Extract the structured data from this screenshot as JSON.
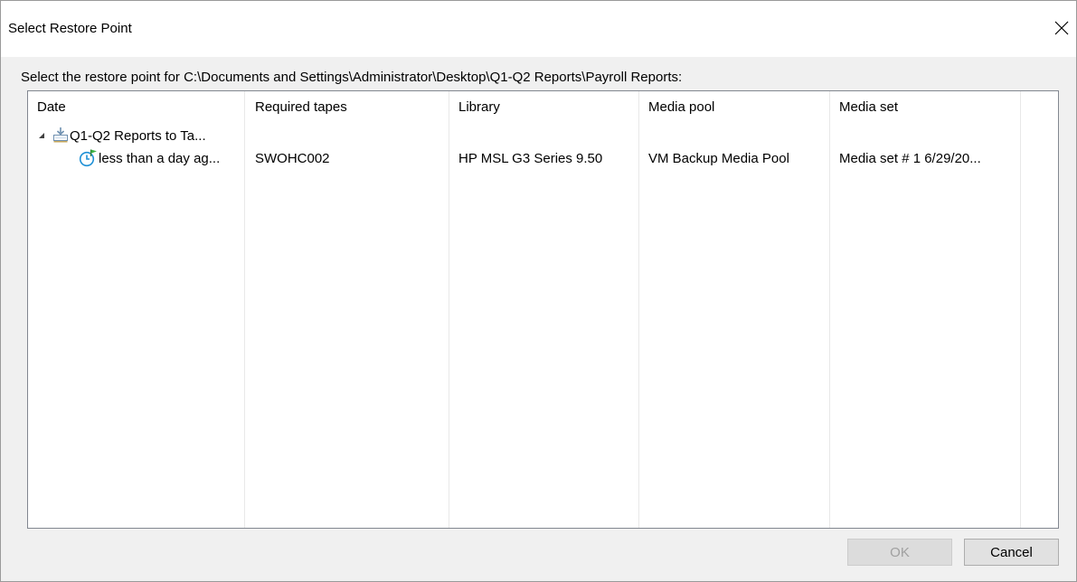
{
  "window": {
    "title": "Select Restore Point"
  },
  "prompt": "Select the restore point for C:\\Documents and Settings\\Administrator\\Desktop\\Q1-Q2 Reports\\Payroll Reports:",
  "table": {
    "columns": [
      "Date",
      "Required tapes",
      "Library",
      "Media pool",
      "Media set"
    ],
    "group": {
      "label": "Q1-Q2 Reports to Ta...",
      "icon": "backup-job-icon",
      "expanded": true
    },
    "rows": [
      {
        "date": "less than a day ag...",
        "icon": "restore-point-clock-icon",
        "required_tapes": "SWOHC002",
        "library": "HP MSL G3 Series 9.50",
        "media_pool": "VM Backup Media Pool",
        "media_set": "Media set # 1 6/29/20..."
      }
    ]
  },
  "buttons": {
    "ok": "OK",
    "cancel": "Cancel"
  },
  "colors": {
    "dialog_bg": "#f0f0f0",
    "list_border": "#828790",
    "clock_blue": "#1e90d6",
    "flag_green": "#3cb043"
  }
}
